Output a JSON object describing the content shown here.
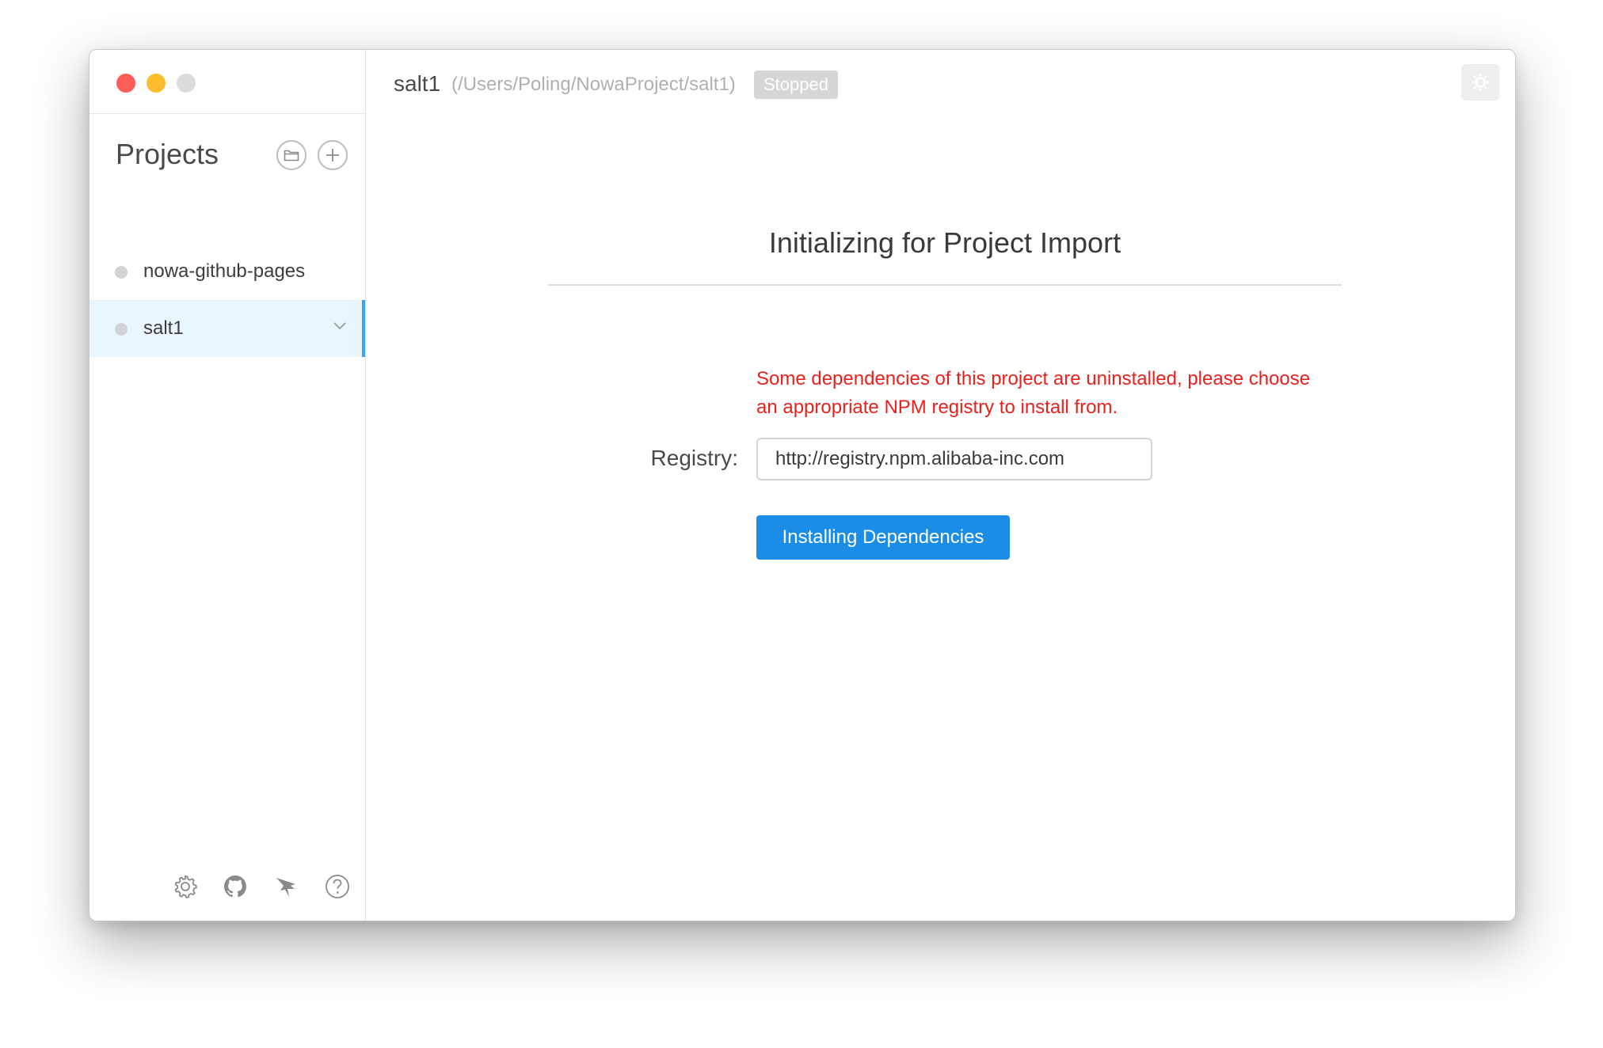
{
  "window": {
    "controls": [
      "close",
      "minimize",
      "maximize"
    ]
  },
  "sidebar": {
    "title": "Projects",
    "actions": [
      {
        "icon": "folder-open-icon"
      },
      {
        "icon": "plus-icon"
      }
    ],
    "projects": [
      {
        "name": "nowa-github-pages",
        "status_color": "#d3d3d3",
        "selected": false
      },
      {
        "name": "salt1",
        "status_color": "#d3d3d3",
        "selected": true
      }
    ],
    "footer_icons": [
      "gear-icon",
      "github-icon",
      "bird-icon",
      "help-icon"
    ]
  },
  "header": {
    "project_name": "salt1",
    "project_path": "(/Users/Poling/NowaProject/salt1)",
    "status": "Stopped"
  },
  "main": {
    "title": "Initializing for Project Import",
    "warning": "Some dependencies of this project are uninstalled, please choose an appropriate NPM registry to install from.",
    "registry_label": "Registry:",
    "registry_value": "http://registry.npm.alibaba-inc.com",
    "install_button": "Installing Dependencies"
  },
  "colors": {
    "accent": "#1c8de6",
    "selection": "#e9f6fe",
    "selection_border": "#3ba6ef",
    "warning": "#e8211d"
  }
}
